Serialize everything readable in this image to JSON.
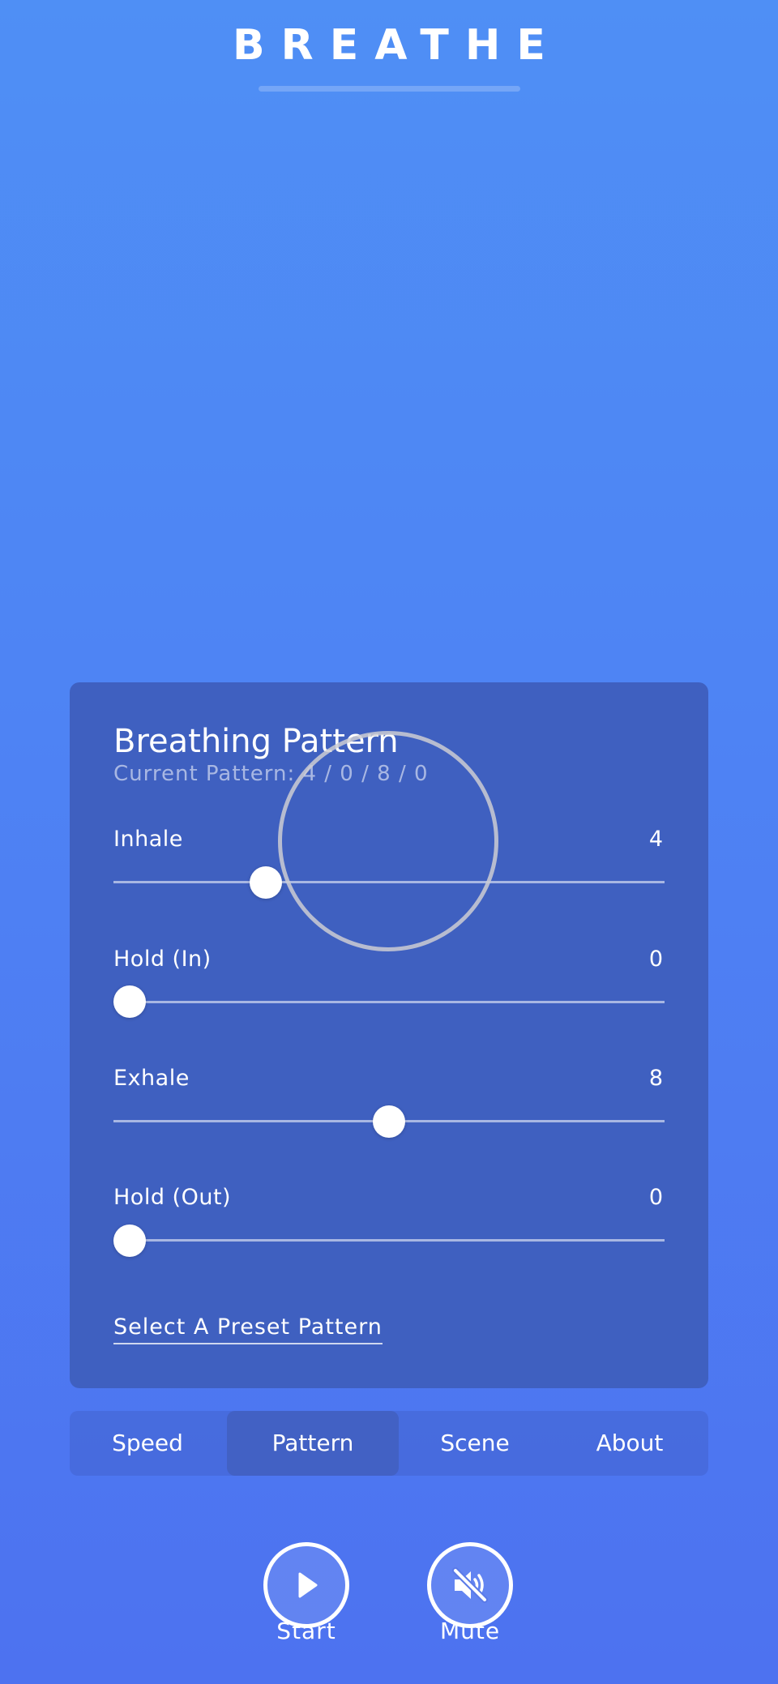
{
  "app": {
    "title": "BREATHE"
  },
  "panel": {
    "title": "Breathing Pattern",
    "current_pattern": "Current Pattern: 4 / 0 / 8 / 0",
    "sliders": [
      {
        "label": "Inhale",
        "value": "4",
        "fraction": 0.263
      },
      {
        "label": "Hold (In)",
        "value": "0",
        "fraction": 0.0
      },
      {
        "label": "Exhale",
        "value": "8",
        "fraction": 0.5
      },
      {
        "label": "Hold (Out)",
        "value": "0",
        "fraction": 0.0
      }
    ],
    "preset_link": "Select A Preset Pattern"
  },
  "tabs": [
    {
      "label": "Speed",
      "active": false
    },
    {
      "label": "Pattern",
      "active": true
    },
    {
      "label": "Scene",
      "active": false
    },
    {
      "label": "About",
      "active": false
    }
  ],
  "controls": {
    "start_label": "Start",
    "mute_label": "Mute",
    "start_icon": "play-icon",
    "mute_icon": "volume-muted-icon"
  },
  "colors": {
    "background_top": "#4f8ff5",
    "background_bottom": "#4d72f0",
    "panel": "#3f60c0",
    "active_tab": "#4261c4"
  }
}
